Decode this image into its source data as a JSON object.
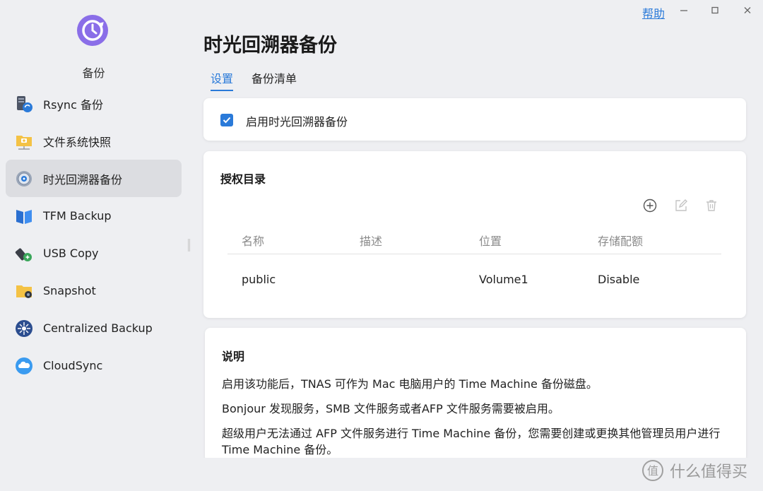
{
  "app": {
    "name": "备份",
    "accent": "#2a7ad9"
  },
  "window": {
    "help": "帮助"
  },
  "sidebar": {
    "items": [
      {
        "label": "Rsync 备份",
        "icon": "server-sync-icon"
      },
      {
        "label": "文件系统快照",
        "icon": "folder-snapshot-icon"
      },
      {
        "label": "时光回溯器备份",
        "icon": "gear-clock-icon",
        "active": true
      },
      {
        "label": "TFM Backup",
        "icon": "book-icon"
      },
      {
        "label": "USB Copy",
        "icon": "usb-icon"
      },
      {
        "label": "Snapshot",
        "icon": "folder-camera-icon"
      },
      {
        "label": "Centralized Backup",
        "icon": "hub-icon"
      },
      {
        "label": "CloudSync",
        "icon": "cloud-icon"
      }
    ]
  },
  "main": {
    "title": "时光回溯器备份",
    "tabs": [
      {
        "label": "设置",
        "active": true
      },
      {
        "label": "备份清单"
      }
    ],
    "enable": {
      "label": "启用时光回溯器备份",
      "checked": true
    },
    "auth": {
      "title": "授权目录",
      "columns": [
        "名称",
        "描述",
        "位置",
        "存储配额"
      ],
      "rows": [
        {
          "name": "public",
          "desc": "",
          "location": "Volume1",
          "quota": "Disable"
        }
      ]
    },
    "notes": {
      "title": "说明",
      "lines": [
        "启用该功能后，TNAS 可作为 Mac 电脑用户的 Time Machine 备份磁盘。",
        "Bonjour 发现服务，SMB 文件服务或者AFP 文件服务需要被启用。",
        "超级用户无法通过 AFP 文件服务进行 Time Machine 备份，您需要创建或更换其他管理员用户进行 Time Machine 备份。"
      ]
    }
  },
  "watermark": {
    "text": "什么值得买"
  }
}
